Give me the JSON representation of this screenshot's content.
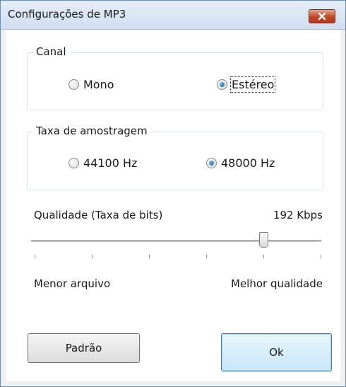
{
  "window": {
    "title": "Configurações de MP3"
  },
  "canal": {
    "label": "Canal",
    "options": [
      {
        "label": "Mono",
        "checked": false
      },
      {
        "label": "Estéreo",
        "checked": true
      }
    ]
  },
  "taxa": {
    "label": "Taxa de amostragem",
    "options": [
      {
        "label": "44100 Hz",
        "checked": false
      },
      {
        "label": "48000 Hz",
        "checked": true
      }
    ]
  },
  "qualidade": {
    "label": "Qualidade (Taxa de bits)",
    "value_text": "192 Kbps",
    "slider_level": 0.8,
    "min_label": "Menor arquivo",
    "max_label": "Melhor qualidade"
  },
  "buttons": {
    "default_label": "Padrão",
    "ok_label": "Ok"
  }
}
